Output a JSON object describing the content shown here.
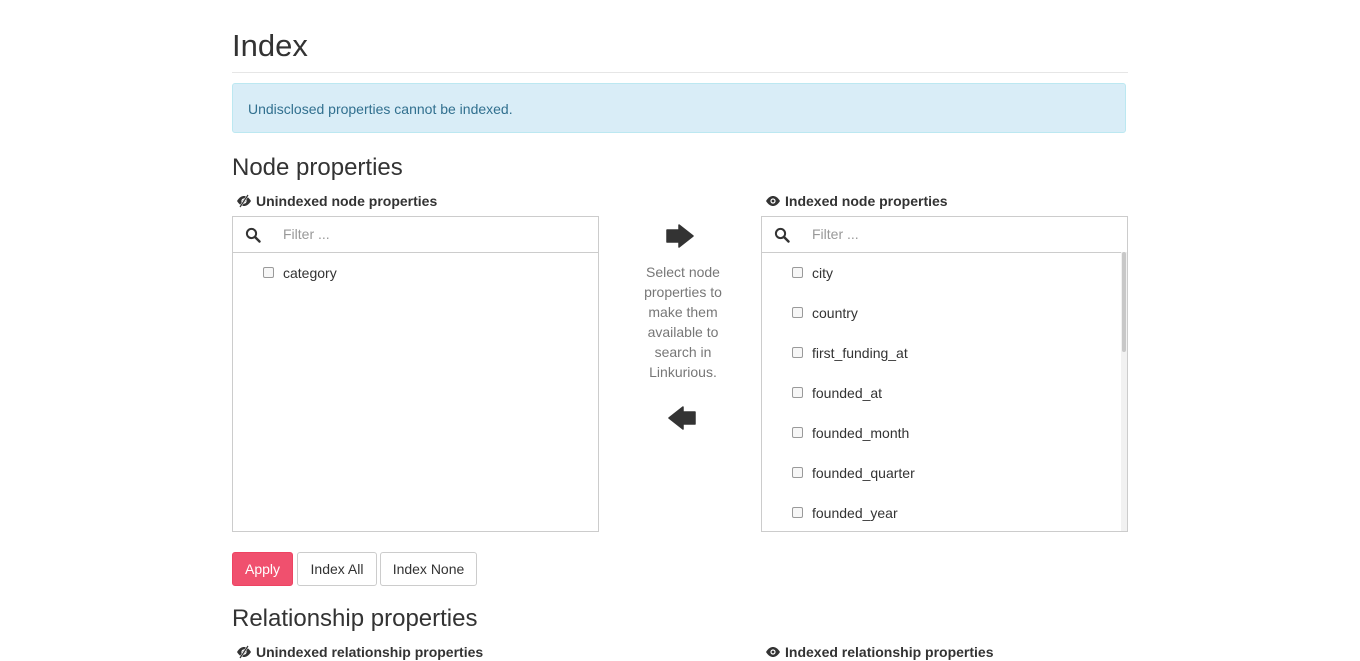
{
  "page": {
    "title": "Index"
  },
  "alert": {
    "text": "Undisclosed properties cannot be indexed."
  },
  "node_section": {
    "title": "Node properties",
    "unindexed": {
      "label": "Unindexed node properties",
      "filter_placeholder": "Filter ...",
      "items": [
        "category"
      ]
    },
    "indexed": {
      "label": "Indexed node properties",
      "filter_placeholder": "Filter ...",
      "items": [
        "city",
        "country",
        "first_funding_at",
        "founded_at",
        "founded_month",
        "founded_quarter",
        "founded_year"
      ]
    },
    "help_text": "Select node properties to make them available to search in Linkurious.",
    "buttons": {
      "apply": "Apply",
      "index_all": "Index All",
      "index_none": "Index None"
    }
  },
  "relationship_section": {
    "title": "Relationship properties",
    "unindexed_label": "Unindexed relationship properties",
    "indexed_label": "Indexed relationship properties"
  },
  "colors": {
    "alert_bg": "#d9edf7",
    "alert_text": "#31708f",
    "primary_button": "#f0506e"
  },
  "icons": {
    "unindexed": "eye-slash-icon",
    "indexed": "eye-icon",
    "search": "search-icon",
    "move_right": "arrow-right-icon",
    "move_left": "arrow-left-icon"
  }
}
